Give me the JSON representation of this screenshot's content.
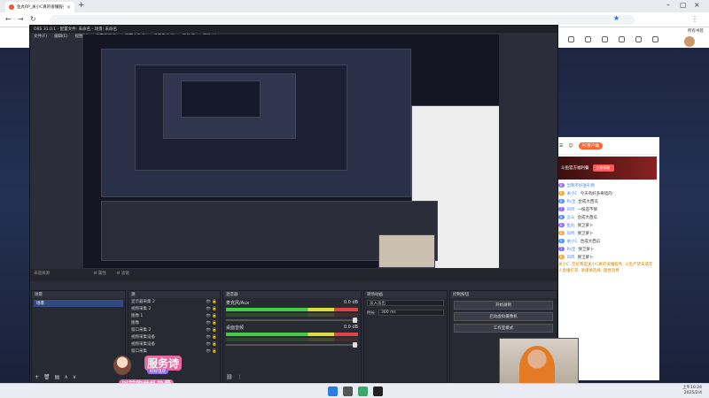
{
  "browser": {
    "tab_title": "鱼丸RP_关小C真的很懂服务_关...",
    "new_tab": "+",
    "bookmarks_right": "所有书签"
  },
  "obs": {
    "title": "OBS 31.0.1 - 配置文件: 未命名 - 场景: 未命名",
    "menu": [
      "文件(F)",
      "编辑(E)",
      "视图(V)",
      "停靠窗口(D)",
      "配置文件(P)",
      "场景集合(S)",
      "工具(T)",
      "帮助(H)"
    ],
    "status_left": "未选择源",
    "props_label": "⚙ 属性",
    "filters_label": "⚙ 滤镜",
    "scenes": {
      "header": "场景",
      "items": [
        "场景"
      ]
    },
    "sources": {
      "header": "源",
      "items": [
        "显示器采集 2",
        "视频采集 2",
        "图像 1",
        "图像",
        "窗口采集 2",
        "视频采集设备",
        "视频采集设备",
        "窗口采集"
      ]
    },
    "mixer": {
      "header": "混音器",
      "channels": [
        {
          "name": "麦克风/Aux",
          "level": "0.0 dB"
        },
        {
          "name": "桌面音频",
          "level": "0.0 dB"
        }
      ]
    },
    "transitions": {
      "header": "转场动画",
      "type": "淡入淡出",
      "duration_label": "时长",
      "duration": "300 ms"
    },
    "controls": {
      "header": "控制按钮",
      "buttons": [
        "开始录制",
        "启动虚拟摄像机",
        "工作室模式"
      ]
    },
    "footer": "00:00:00  00:00:00"
  },
  "chat": {
    "pc_label": "PC客户端",
    "ad_text": "斗鱼官方福利餐",
    "ad_button": "立即领取",
    "rows": [
      {
        "badge": "8",
        "name": "当我不好送礼物",
        "text": ""
      },
      {
        "badge": "9",
        "name": "关小C",
        "text": "今天有好多奇怪的"
      },
      {
        "badge": "8",
        "name": "Pa宝",
        "text": "合成大西瓜"
      },
      {
        "badge": "7",
        "name": "凤鸣",
        "text": "一枝还不够"
      },
      {
        "badge": "8",
        "name": "怎么",
        "text": "合成大西瓜"
      },
      {
        "badge": "6",
        "name": "鱼丸",
        "text": "保卫萝卜"
      },
      {
        "badge": "8",
        "name": "凤鸣",
        "text": "保卫萝卜"
      },
      {
        "badge": "9",
        "name": "关小C",
        "text": "合成大西瓜"
      },
      {
        "badge": "7",
        "name": "Pa宝",
        "text": "保卫萝卜"
      },
      {
        "badge": "8",
        "name": "凤鸣",
        "text": "保卫萝卜"
      }
    ],
    "announcement": "关小C: 您好我是关小C真的很懂服务, 斗鱼严禁未成年人直播打赏, 请谨慎选择, 理性消费"
  },
  "sticker": {
    "main": "服务诗",
    "sub": "好好电玩",
    "bottom": "以前的共扑热爱"
  },
  "taskbar": {
    "time": "上午10:24",
    "date": "2025/2/4"
  },
  "colors": {
    "obs_bg": "#2b2e38",
    "scene_selected": "#324a80",
    "accent_chat": "#f63",
    "badge_purple": "#8e6cf0"
  }
}
